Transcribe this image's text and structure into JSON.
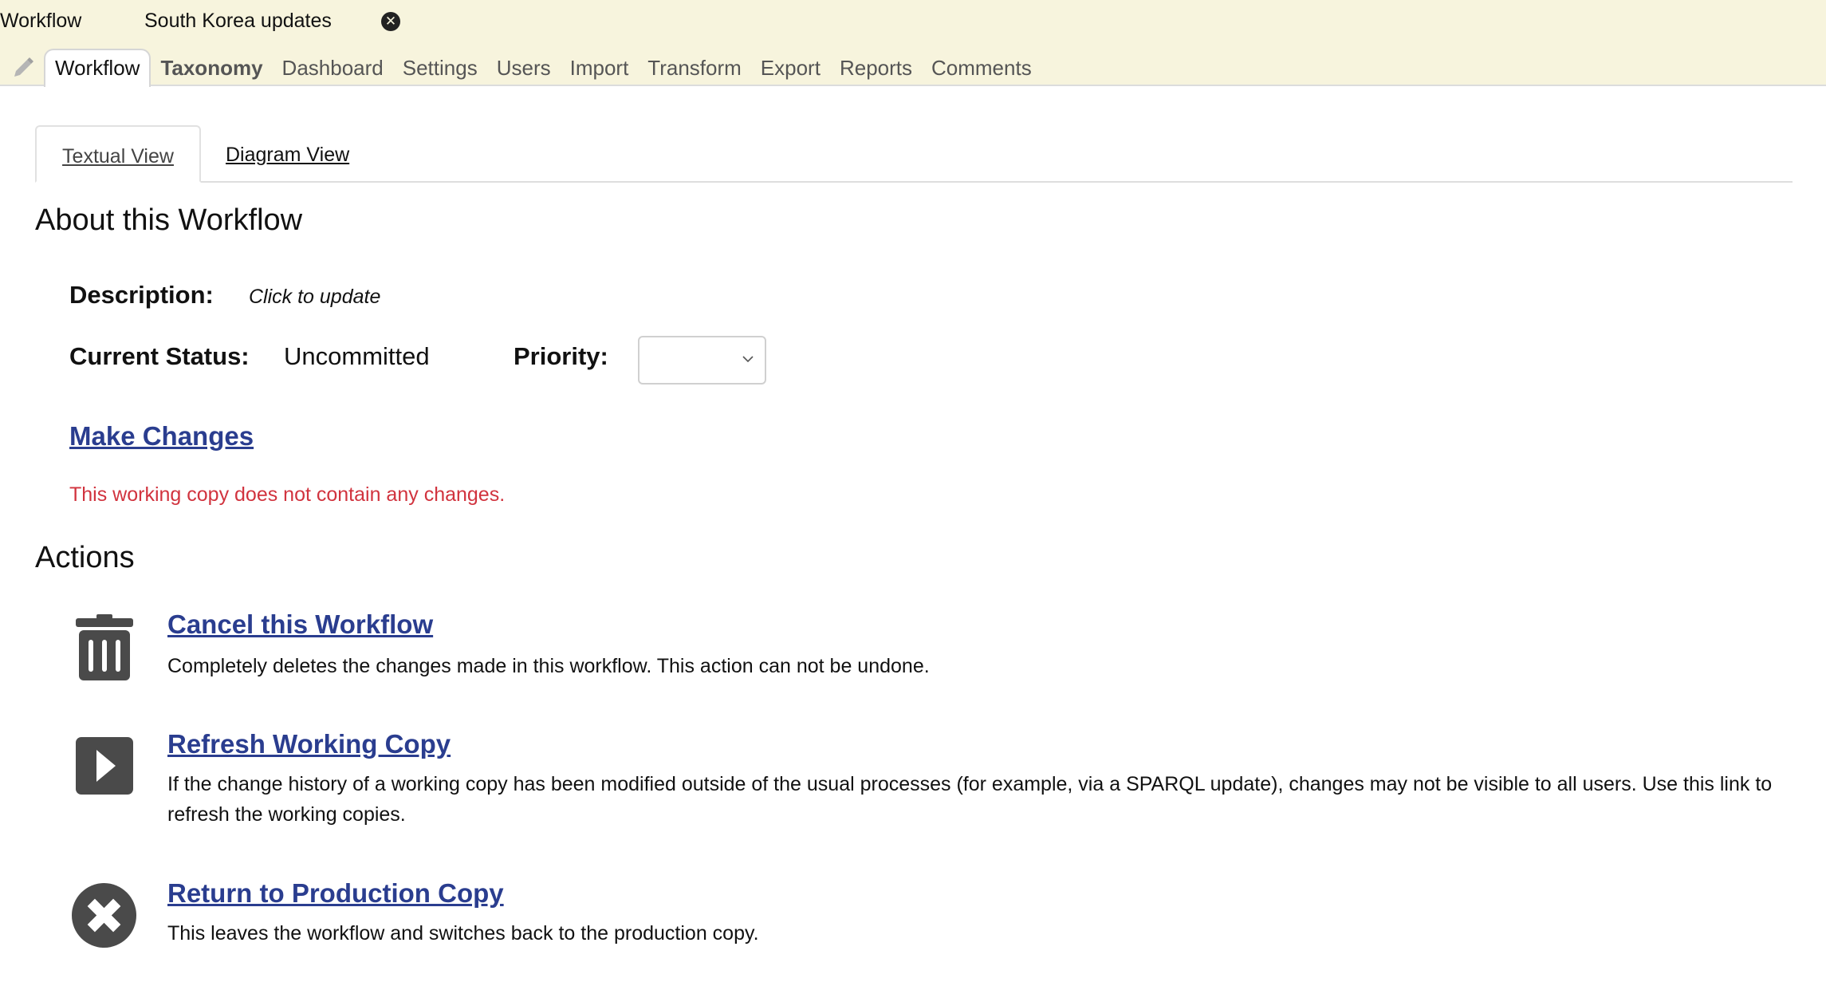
{
  "header": {
    "app_title": "Workflow",
    "workflow_name": "South Korea updates",
    "close_icon": "close-circle-icon",
    "edit_icon": "pencil-icon",
    "nav_tabs": [
      {
        "label": "Workflow",
        "active": true
      },
      {
        "label": "Taxonomy",
        "bold": true
      },
      {
        "label": "Dashboard"
      },
      {
        "label": "Settings"
      },
      {
        "label": "Users"
      },
      {
        "label": "Import"
      },
      {
        "label": "Transform"
      },
      {
        "label": "Export"
      },
      {
        "label": "Reports"
      },
      {
        "label": "Comments"
      }
    ],
    "background_color": "#f7f4dd"
  },
  "view_tabs": [
    {
      "label": "Textual View",
      "active": true
    },
    {
      "label": "Diagram View"
    }
  ],
  "about": {
    "heading": "About this Workflow",
    "description_label": "Description:",
    "description_value": "Click to update",
    "status_label": "Current Status:",
    "status_value": "Uncommitted",
    "priority_label": "Priority:",
    "priority_value": "",
    "make_changes_label": "Make Changes",
    "no_changes_message": "This working copy does not contain any changes."
  },
  "actions": {
    "heading": "Actions",
    "items": [
      {
        "icon": "trash-icon",
        "label": "Cancel this Workflow",
        "description": "Completely deletes the changes made in this workflow. This action can not be undone."
      },
      {
        "icon": "play-icon",
        "label": "Refresh Working Copy",
        "description": "If the change history of a working copy has been modified outside of the usual processes (for example, via a SPARQL update), changes may not be visible to all users. Use this link to refresh the working copies."
      },
      {
        "icon": "close-circle-icon",
        "label": "Return to Production Copy",
        "description": "This leaves the workflow and switches back to the production copy."
      }
    ]
  },
  "colors": {
    "link": "#2a3d8f",
    "warning": "#d1333e",
    "icon": "#4a4a4a"
  }
}
